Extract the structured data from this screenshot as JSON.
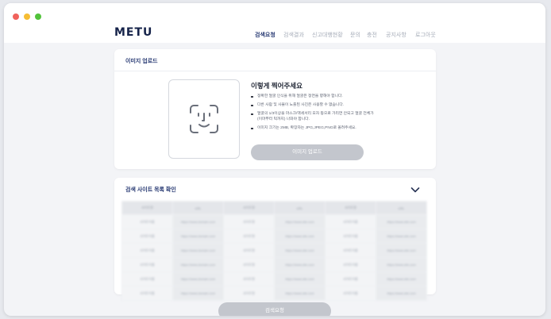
{
  "app": {
    "logo": "METU"
  },
  "nav": {
    "items": [
      {
        "label": "검색요청",
        "active": true
      },
      {
        "label": "검색결과",
        "active": false
      },
      {
        "label": "신고대행현황",
        "active": false
      },
      {
        "label": "문의",
        "active": false
      },
      {
        "label": "충전",
        "active": false
      },
      {
        "label": "공지사항",
        "active": false
      },
      {
        "label": "로그아웃",
        "active": false
      }
    ]
  },
  "upload": {
    "section_title": "이미지 업로드",
    "guide_title": "이렇게 찍어주세요",
    "guides": [
      "정확한 얼굴 인식을 위해 얼굴은 정면을 향해야 합니다.",
      "다른 사람 및 사물이 노출된 사진은 사용할 수 없습니다.",
      "얼굴의 1/3이상을 마스크/액세서리 모자 등으로 가리면 안되고 얼굴 전체가 (이마부터 턱까지) 나와야 합니다.",
      "이미지 크기는 2MB, 확장자는 JPG,JPEG,PNG로 올려주세요."
    ],
    "button_label": "이미지 업로드",
    "icon": "face-id-icon"
  },
  "sites": {
    "section_title": "검색 사이트 목록 확인",
    "table": {
      "headers": [
        "사이트명",
        "URL",
        "사이트명",
        "URL",
        "사이트명",
        "URL"
      ],
      "rows": [
        [
          "사이트이름",
          "https://www.domain.com",
          "사이트명",
          "https://www.site.com",
          "사이트이름",
          "https://www.site.com"
        ],
        [
          "사이트이름",
          "https://www.domain.com",
          "사이트명",
          "https://www.site.com",
          "사이트이름",
          "https://www.site.com"
        ],
        [
          "사이트이름",
          "https://www.domain.com",
          "사이트명",
          "https://www.site.com",
          "사이트이름",
          "https://www.site.com"
        ],
        [
          "사이트이름",
          "https://www.domain.com",
          "사이트명",
          "https://www.site.com",
          "사이트이름",
          "https://www.site.com"
        ],
        [
          "사이트이름",
          "https://www.domain.com",
          "사이트명",
          "https://www.site.com",
          "사이트이름",
          "https://www.site.com"
        ],
        [
          "사이트이름",
          "https://www.domain.com",
          "사이트명",
          "https://www.site.com",
          "사이트이름",
          "https://www.site.com"
        ]
      ]
    }
  },
  "footer": {
    "submit_label": "검색요청"
  },
  "colors": {
    "accent": "#283a73",
    "button_disabled": "#c3c6cd",
    "background": "#f3f4f7"
  }
}
